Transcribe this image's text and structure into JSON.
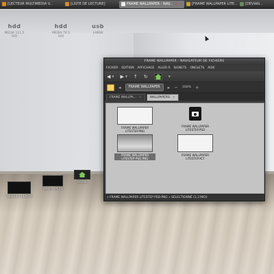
{
  "top_panel": {
    "tasks": [
      {
        "label": "[LECTEUR MULTIMEDIA V...",
        "active": false
      },
      {
        "label": "[LISTE DE LECTURE]",
        "active": false
      },
      {
        "label": "FRAME WALLPAPER - NAV...",
        "active": true
      },
      {
        "label": "[FRAME WALLPAPER LITE...",
        "active": false
      },
      {
        "label": "[DEVIAN...",
        "active": false
      }
    ]
  },
  "desktop": {
    "drives": [
      {
        "name": "hdd",
        "sub": "MEDIA 111,5 GIO"
      },
      {
        "name": "hdd",
        "sub": "MEDIA 74,5 GIO"
      },
      {
        "name": "usb",
        "sub": "LAB08"
      }
    ],
    "dock": [
      {
        "label": "DOSSIER PERSO"
      },
      {
        "label": "WALLPAPERS"
      },
      {
        "label": "HOME"
      }
    ]
  },
  "file_manager": {
    "title": "FRAME WALLPAPER - NAVIGATEUR DE FICHIERS",
    "menu": [
      "FICHIER",
      "EDITION",
      "AFFICHAGE",
      "ALLER À",
      "SIGNETS",
      "ONGLETS",
      "AIDE"
    ],
    "location": {
      "crumb": "FRAME WALLPAPER",
      "zoom": "100%"
    },
    "tabs": [
      {
        "label": "FRAME WALLPA...",
        "active": false
      },
      {
        "label": "WALLPAPERS",
        "active": true
      }
    ],
    "files": [
      {
        "name": "FRAME WALLPAPER LITESTEP.PNG",
        "kind": "thumb",
        "selected": false
      },
      {
        "name": "FRAME WALLPAPER LITESTEP.PSD",
        "kind": "png-icon",
        "selected": false
      },
      {
        "name": "FRAME WALLPAPER LITESTEP PSD.PNG",
        "kind": "thumb-dark",
        "selected": true
      },
      {
        "name": "FRAME WALLPAPER LITESTEP.XCF",
        "kind": "thumb",
        "selected": false
      }
    ],
    "status": "« FRAME WALLPAPER LITESTEP PSD.PNG » SÉLECTIONNÉ (1,3 MIO)"
  }
}
